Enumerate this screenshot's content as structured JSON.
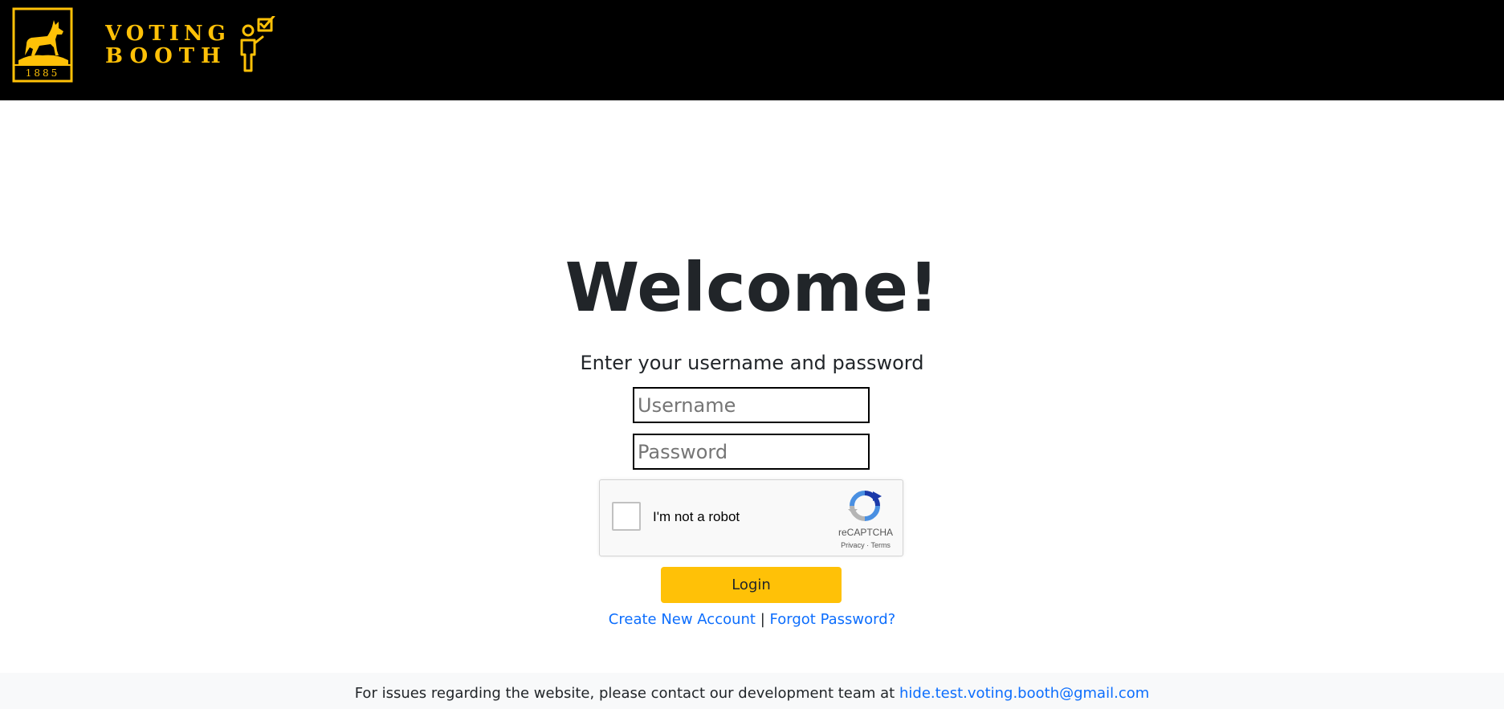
{
  "header": {
    "crest_year": "1885",
    "brand_line1": "VOTING",
    "brand_line2": "BOOTH",
    "brand_color": "#ffc107"
  },
  "main": {
    "title": "Welcome!",
    "subtitle": "Enter your username and password",
    "username_placeholder": "Username",
    "password_placeholder": "Password",
    "login_label": "Login",
    "create_account_label": "Create New Account",
    "link_separator": "|",
    "forgot_password_label": "Forgot Password?"
  },
  "recaptcha": {
    "label": "I'm not a robot",
    "brand": "reCAPTCHA",
    "privacy": "Privacy",
    "dot": "·",
    "terms": "Terms"
  },
  "footer": {
    "text": "For issues regarding the website, please contact our development team at",
    "email": "hide.test.voting.booth@gmail.com"
  },
  "colors": {
    "accent": "#ffc107",
    "link": "#0d6efd",
    "header_bg": "#000000"
  }
}
